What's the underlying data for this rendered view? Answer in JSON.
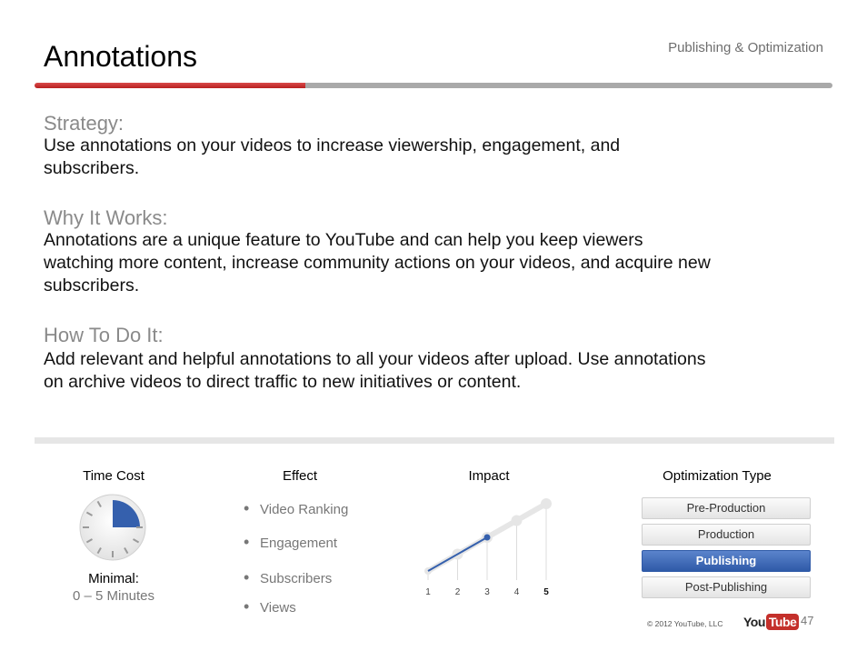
{
  "title": "Annotations",
  "section_label": "Publishing & Optimization",
  "strategy": {
    "heading": "Strategy:",
    "text": "Use annotations on your videos to increase viewership, engagement, and subscribers."
  },
  "why": {
    "heading": "Why It Works:",
    "text": "Annotations are a unique feature to YouTube and can help you keep viewers watching more content, increase community actions on your videos, and acquire new subscribers."
  },
  "how": {
    "heading": "How To Do It:",
    "text": "Add relevant and helpful annotations to all your videos after upload. Use annotations on archive videos to direct traffic to new initiatives or content."
  },
  "time_cost": {
    "title": "Time Cost",
    "level_label": "Minimal:",
    "range": "0 – 5 Minutes",
    "clock_fraction": 0.25
  },
  "effect": {
    "title": "Effect",
    "items": [
      "Video Ranking",
      "Engagement",
      "Subscribers",
      "Views"
    ]
  },
  "impact": {
    "title": "Impact",
    "scale": [
      "1",
      "2",
      "3",
      "4",
      "5"
    ],
    "value": 3
  },
  "optimization": {
    "title": "Optimization Type",
    "options": [
      "Pre-Production",
      "Production",
      "Publishing",
      "Post-Publishing"
    ],
    "selected": "Publishing"
  },
  "footer": {
    "copyright": "© 2012 YouTube, LLC",
    "logo_you": "You",
    "logo_tube": "Tube",
    "page_number": "47"
  },
  "colors": {
    "accent_red": "#c4302b",
    "accent_blue": "#2f5aa8",
    "heading_grey": "#8a8a8a"
  }
}
